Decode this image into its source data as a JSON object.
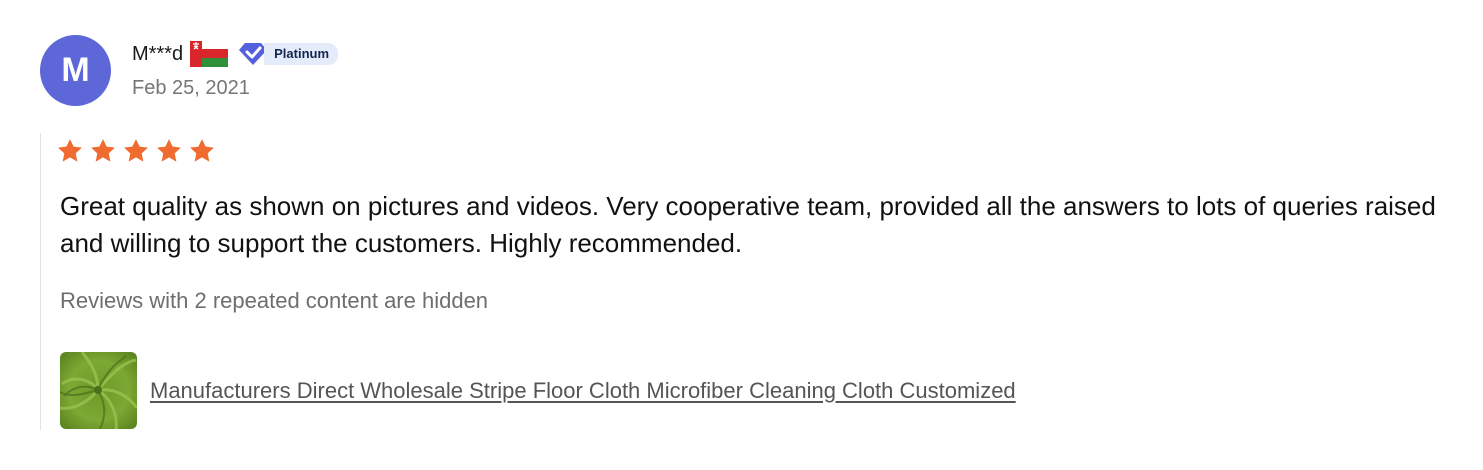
{
  "reviewer": {
    "avatar_initial": "M",
    "avatar_color": "#5d67d8",
    "name": "M***d",
    "country_flag": "oman-flag-icon",
    "badge_label": "Platinum",
    "date": "Feb 25, 2021"
  },
  "rating": {
    "value": 5,
    "max": 5,
    "star_color": "#f06b2f"
  },
  "review": {
    "text": "Great quality as shown on pictures and videos. Very cooperative team, provided all the answers to lots of queries raised and willing to support the customers. Highly recommended.",
    "hidden_note": "Reviews with 2 repeated content are hidden"
  },
  "product": {
    "title": "Manufacturers Direct Wholesale Stripe Floor Cloth Microfiber Cleaning Cloth Customized",
    "thumbnail": "green-microfiber-cloth-image"
  }
}
